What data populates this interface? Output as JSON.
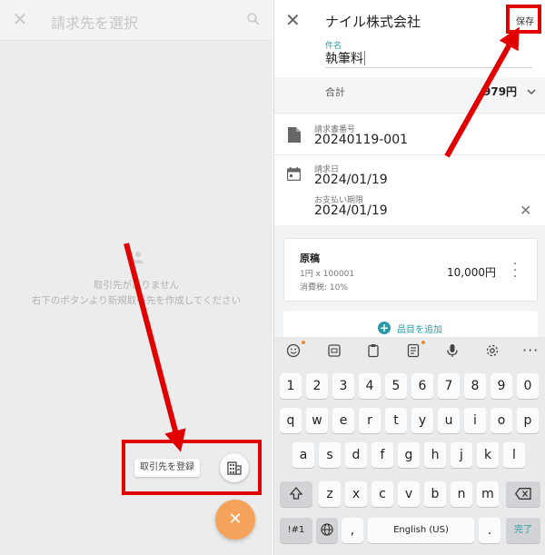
{
  "left_panel": {
    "search_placeholder": "請求先を選択",
    "empty_line1": "取引先がありません",
    "empty_line2": "右下のボタンより新規取引先を作成してください",
    "register_chip": "取引先を登録"
  },
  "right_panel": {
    "title": "ナイル株式会社",
    "save_label": "保存",
    "subject_label": "件名",
    "subject_value": "執筆料",
    "total_label": "合計",
    "total_value": "979円",
    "invoice_no_label": "請求書番号",
    "invoice_no_value": "20240119-001",
    "invoice_date_label": "請求日",
    "invoice_date_value": "2024/01/19",
    "due_date_label": "お支払い期限",
    "due_date_value": "2024/01/19",
    "item": {
      "name": "原稿",
      "qty": "1円 x 100001",
      "tax": "消費税: 10%",
      "amount": "10,000円"
    },
    "add_item_label": "品目を追加"
  },
  "keyboard": {
    "number_row": [
      "1",
      "2",
      "3",
      "4",
      "5",
      "6",
      "7",
      "8",
      "9",
      "0"
    ],
    "row1": [
      "q",
      "w",
      "e",
      "r",
      "t",
      "y",
      "u",
      "i",
      "o",
      "p"
    ],
    "row2": [
      "a",
      "s",
      "d",
      "f",
      "g",
      "h",
      "j",
      "k",
      "l"
    ],
    "row3": [
      "z",
      "x",
      "c",
      "v",
      "b",
      "n",
      "m"
    ],
    "symbols_key": "!#1",
    "comma_key": ",",
    "space_label": "English (US)",
    "period_key": ".",
    "done_key": "完了"
  },
  "colors": {
    "accent": "#2a9aa8",
    "fab": "#f5a25a",
    "annotation": "#e00000"
  }
}
